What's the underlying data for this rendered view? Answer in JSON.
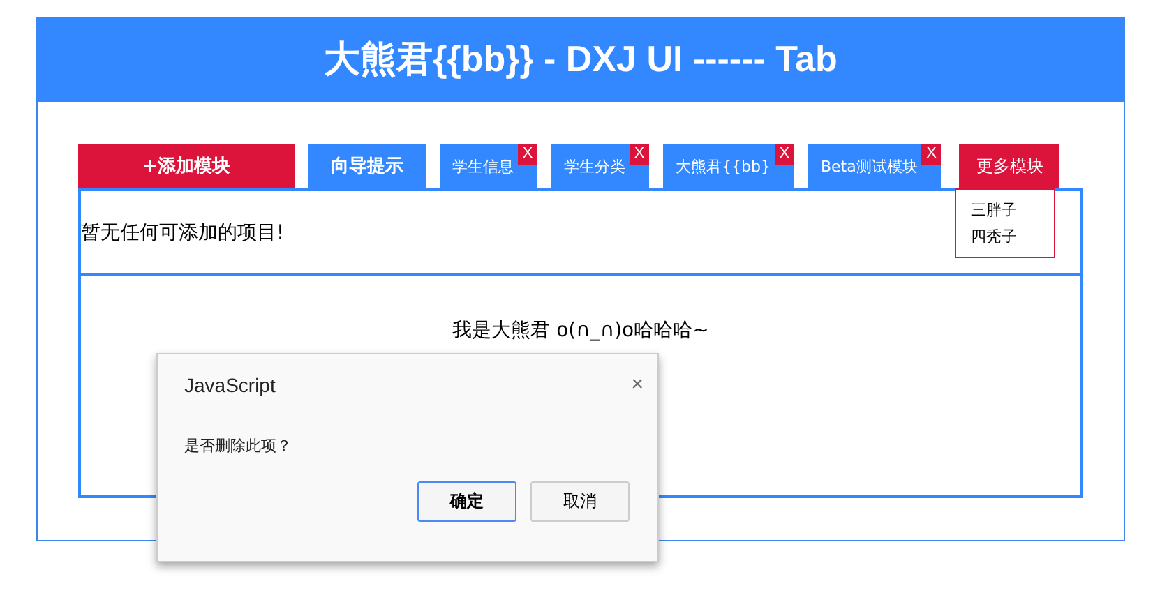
{
  "header": {
    "title": "大熊君{{bb}} - DXJ UI ------ Tab"
  },
  "tabs": [
    {
      "kind": "add",
      "label": "+添加模块",
      "closable": false
    },
    {
      "kind": "tab",
      "label": "向导提示",
      "closable": false
    },
    {
      "kind": "tab",
      "label": "学生信息",
      "closable": true,
      "close_label": "X"
    },
    {
      "kind": "tab",
      "label": "学生分类",
      "closable": true,
      "close_label": "X"
    },
    {
      "kind": "tab",
      "label": "大熊君{{bb}",
      "closable": true,
      "close_label": "X"
    },
    {
      "kind": "tab",
      "label": "Beta测试模块",
      "closable": true,
      "close_label": "X"
    },
    {
      "kind": "more",
      "label": "更多模块",
      "closable": false
    }
  ],
  "more_menu": {
    "items": [
      "三胖子",
      "四秃子"
    ]
  },
  "add_panel": {
    "message": "暂无任何可添加的项目!"
  },
  "content": {
    "text": "我是大熊君 o(∩_∩)o哈哈哈~"
  },
  "dialog": {
    "title": "JavaScript",
    "close": "×",
    "message": "是否删除此项？",
    "buttons": [
      {
        "label": "确定",
        "primary": true
      },
      {
        "label": "取消",
        "primary": false
      }
    ]
  }
}
